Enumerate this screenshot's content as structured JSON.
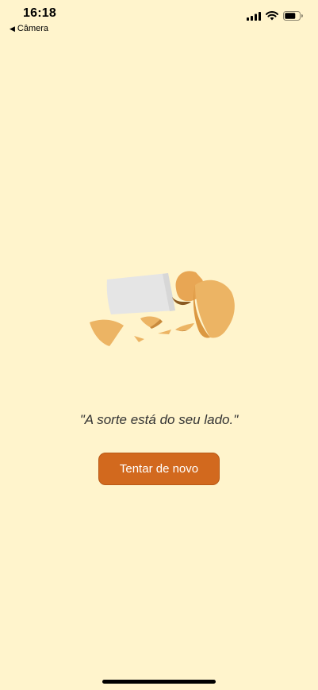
{
  "status_bar": {
    "time": "16:18",
    "back_label": "Câmera",
    "icons": [
      "signal-icon",
      "wifi-icon",
      "battery-icon"
    ]
  },
  "main": {
    "fortune_message": "\"A sorte está do seu lado.\"",
    "retry_label": "Tentar de novo",
    "illustration": "broken-fortune-cookie"
  },
  "colors": {
    "background": "#FFF4CC",
    "button": "#D2691E",
    "cookie": "#ECB464",
    "paper": "#E4E4E4"
  }
}
